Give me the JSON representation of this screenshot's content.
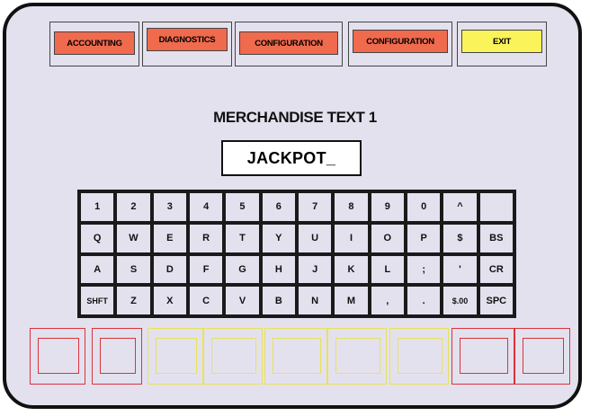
{
  "nav": {
    "buttons": [
      {
        "label": "ACCOUNTING",
        "color": "#f06a4e"
      },
      {
        "label": "DIAGNOSTICS",
        "color": "#f06a4e"
      },
      {
        "label": "CONFIGURATION",
        "color": "#f06a4e"
      },
      {
        "label": "CONFIGURATION",
        "color": "#f06a4e"
      },
      {
        "label": "EXIT",
        "color": "#fbf35a"
      }
    ]
  },
  "screen": {
    "title": "MERCHANDISE TEXT 1",
    "text_value": "JACKPOT_"
  },
  "keyboard": {
    "rows": [
      [
        "1",
        "2",
        "3",
        "4",
        "5",
        "6",
        "7",
        "8",
        "9",
        "0",
        "^",
        ""
      ],
      [
        "Q",
        "W",
        "E",
        "R",
        "T",
        "Y",
        "U",
        "I",
        "O",
        "P",
        "$",
        "BS"
      ],
      [
        "A",
        "S",
        "D",
        "F",
        "G",
        "H",
        "J",
        "K",
        "L",
        ";",
        "'",
        "CR"
      ],
      [
        "SHFT",
        "Z",
        "X",
        "C",
        "V",
        "B",
        "N",
        "M",
        ",",
        ".",
        "$.00",
        "SPC"
      ]
    ]
  },
  "soft_buttons": {
    "colors": [
      "red",
      "red",
      "yellow",
      "yellow",
      "yellow",
      "yellow",
      "yellow",
      "red",
      "red"
    ]
  },
  "colors": {
    "accent_red": "#f06a4e",
    "accent_yellow": "#fbf35a",
    "panel_bg": "#e4e1ee",
    "soft_red": "#d9333a",
    "soft_yellow": "#e8e25a"
  }
}
